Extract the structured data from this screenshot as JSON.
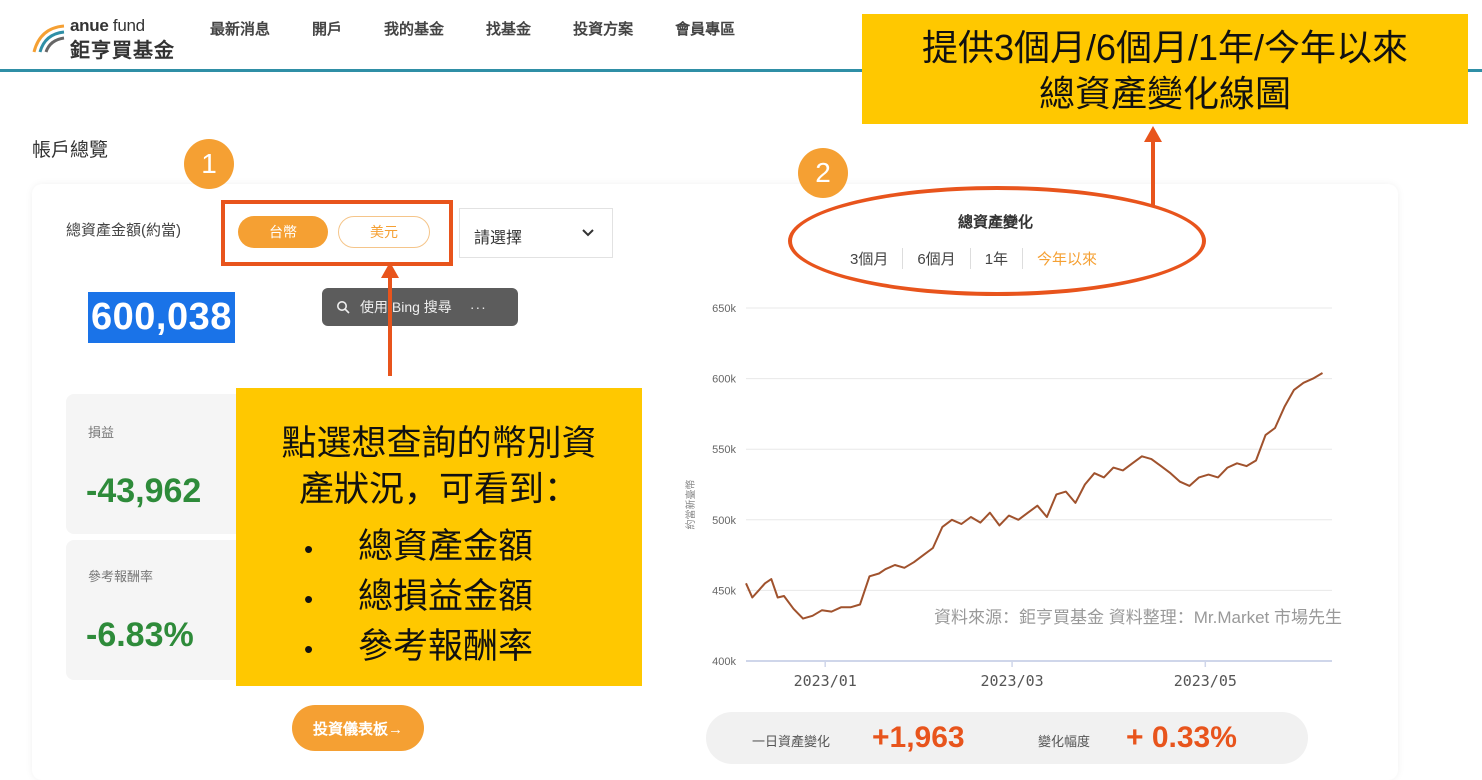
{
  "header": {
    "logo_en_bold": "anue",
    "logo_en_light": " fund",
    "logo_zh": "鉅亨買基金",
    "nav": [
      "最新消息",
      "開戶",
      "我的基金",
      "找基金",
      "投資方案",
      "會員專區"
    ]
  },
  "page_title": "帳戶總覽",
  "account": {
    "total_label": "總資產金額(約當)",
    "currency_twd": "台幣",
    "currency_usd": "美元",
    "select_placeholder": "請選擇",
    "total_value": "600,038",
    "pnl_label": "損益",
    "pnl_value": "-43,962",
    "return_label": "參考報酬率",
    "return_value": "-6.83%",
    "dashboard_button": "投資儀表板→"
  },
  "bing_popup": {
    "text": "使用 Bing 搜尋",
    "more": "···"
  },
  "chart_panel": {
    "title": "總資產變化",
    "periods": [
      "3個月",
      "6個月",
      "1年",
      "今年以來"
    ],
    "active_period": "今年以來",
    "day_change_label": "一日資產變化",
    "day_change_value": "+1,963",
    "change_pct_label": "變化幅度",
    "change_pct_value": "+ 0.33%"
  },
  "chart_data": {
    "type": "line",
    "ylabel": "約當新臺幣",
    "ylim": [
      400000,
      650000
    ],
    "yticks": [
      400000,
      450000,
      500000,
      550000,
      600000,
      650000
    ],
    "ytick_labels": [
      "400k",
      "450k",
      "500k",
      "550k",
      "600k",
      "650k"
    ],
    "xlim": [
      "2022-12-07",
      "2023-06-10"
    ],
    "xticks": [
      "2023-01-01",
      "2023-03-01",
      "2023-05-01"
    ],
    "xtick_labels": [
      "2023/01",
      "2023/03",
      "2023/05"
    ],
    "grid": "horizontal",
    "color": "#a0522d",
    "series": [
      {
        "x": [
          "2022-12-07",
          "2022-12-09",
          "2022-12-11",
          "2022-12-13",
          "2022-12-15",
          "2022-12-17",
          "2022-12-19",
          "2022-12-22",
          "2022-12-25",
          "2022-12-28",
          "2022-12-31",
          "2023-01-03",
          "2023-01-06",
          "2023-01-09",
          "2023-01-12",
          "2023-01-15",
          "2023-01-18",
          "2023-01-20",
          "2023-01-23",
          "2023-01-26",
          "2023-01-29",
          "2023-02-01",
          "2023-02-04",
          "2023-02-07",
          "2023-02-10",
          "2023-02-13",
          "2023-02-16",
          "2023-02-19",
          "2023-02-22",
          "2023-02-25",
          "2023-02-28",
          "2023-03-03",
          "2023-03-06",
          "2023-03-09",
          "2023-03-12",
          "2023-03-15",
          "2023-03-18",
          "2023-03-21",
          "2023-03-24",
          "2023-03-27",
          "2023-03-30",
          "2023-04-02",
          "2023-04-05",
          "2023-04-08",
          "2023-04-11",
          "2023-04-14",
          "2023-04-17",
          "2023-04-20",
          "2023-04-23",
          "2023-04-26",
          "2023-04-29",
          "2023-05-02",
          "2023-05-05",
          "2023-05-08",
          "2023-05-11",
          "2023-05-14",
          "2023-05-17",
          "2023-05-20",
          "2023-05-23",
          "2023-05-26",
          "2023-05-29",
          "2023-06-01",
          "2023-06-04",
          "2023-06-07"
        ],
        "y": [
          455000,
          445000,
          450000,
          455000,
          458000,
          445000,
          446000,
          437000,
          430000,
          432000,
          436000,
          435000,
          438000,
          438000,
          440000,
          460000,
          462000,
          465000,
          468000,
          466000,
          470000,
          475000,
          480000,
          495000,
          500000,
          497000,
          502000,
          498000,
          505000,
          496000,
          503000,
          500000,
          505000,
          510000,
          502000,
          518000,
          520000,
          512000,
          525000,
          533000,
          530000,
          537000,
          535000,
          540000,
          545000,
          543000,
          538000,
          533000,
          527000,
          524000,
          530000,
          532000,
          530000,
          537000,
          540000,
          538000,
          542000,
          560000,
          565000,
          580000,
          592000,
          597000,
          600000,
          604000
        ]
      }
    ]
  },
  "annotations": {
    "num1": "1",
    "num2": "2",
    "callout1_line1": "點選想查詢的幣別資",
    "callout1_line2": "產狀況，可看到：",
    "callout1_bullets": [
      "總資產金額",
      "總損益金額",
      "參考報酬率"
    ],
    "bullet_char": "•",
    "callout2_line1": "提供3個月/6個月/1年/今年以來",
    "callout2_line2": "總資產變化線圖",
    "source": "資料來源：鉅亨買基金  資料整理：Mr.Market 市場先生"
  }
}
